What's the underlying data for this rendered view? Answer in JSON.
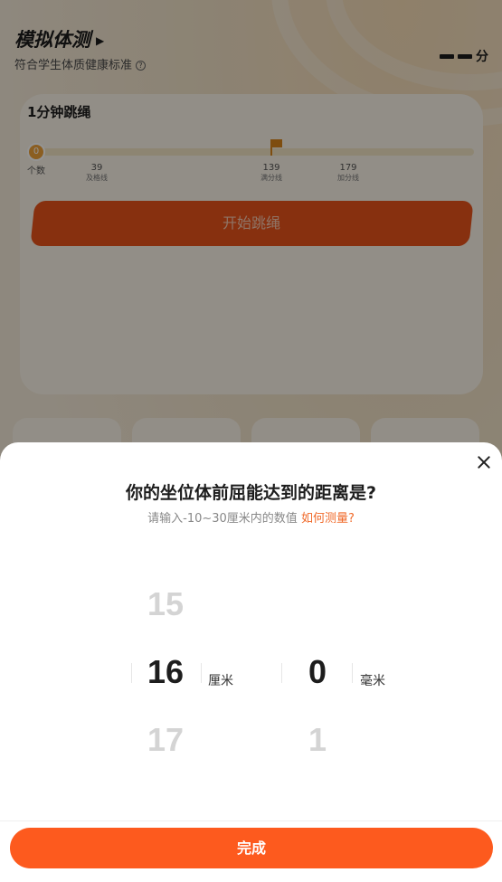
{
  "header": {
    "title": "模拟体测",
    "subtitle": "符合学生体质健康标准",
    "score_unit": "分"
  },
  "card": {
    "title": "1分钟跳绳",
    "knob_text": "0",
    "count_label": "个数",
    "ticks": [
      {
        "value": "39",
        "label": "及格线"
      },
      {
        "value": "139",
        "label": "满分线"
      },
      {
        "value": "179",
        "label": "加分线"
      }
    ],
    "start_button": "开始跳绳"
  },
  "sheet": {
    "title": "你的坐位体前屈能达到的距离是?",
    "hint": "请输入-10~30厘米内的数值",
    "hint_link": "如何测量?",
    "cm_picker": {
      "prev": "15",
      "selected": "16",
      "next": "17",
      "unit": "厘米"
    },
    "mm_picker": {
      "selected": "0",
      "next": "1",
      "unit": "毫米"
    },
    "done_button": "完成"
  }
}
